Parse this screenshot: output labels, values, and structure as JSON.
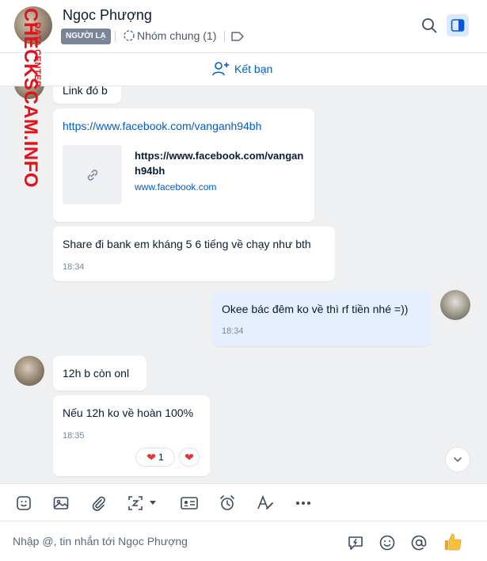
{
  "header": {
    "contact_name": "Ngọc Phượng",
    "stranger_badge": "NGƯỜI LẠ",
    "common_groups": "Nhóm chung (1)"
  },
  "friend_bar": {
    "add_friend_label": "Kết bạn"
  },
  "messages": [
    {
      "id": "m1",
      "side": "in",
      "text": "Link đó b"
    },
    {
      "id": "m2",
      "side": "in",
      "url": "https://www.facebook.com/vanganh94bh",
      "card_title": "https://www.facebook.com/vanganh94bh",
      "card_domain": "www.facebook.com"
    },
    {
      "id": "m3",
      "side": "in",
      "text": "Share đi bank em kháng 5 6 tiếng về chạy như bth",
      "time": "18:34"
    },
    {
      "id": "m4",
      "side": "out",
      "text": "Okee bác đêm ko về thì rf tiền nhé =))",
      "time": "18:34"
    },
    {
      "id": "m5",
      "side": "in",
      "text": "12h b còn onl"
    },
    {
      "id": "m6",
      "side": "in",
      "text": "Nếu 12h ko về hoàn 100%",
      "time": "18:35",
      "reaction_count": "1"
    }
  ],
  "composer": {
    "placeholder": "Nhập @, tin nhắn tới Ngọc Phượng"
  },
  "watermark": {
    "main": "CHECKSCAM.INFO",
    "sub": "DATA CENTER"
  },
  "colors": {
    "accent": "#005ae0",
    "outgoing_bubble": "#e5efff",
    "badge": "#7a8599",
    "heart": "#e8323c",
    "watermark": "#e3131b"
  }
}
